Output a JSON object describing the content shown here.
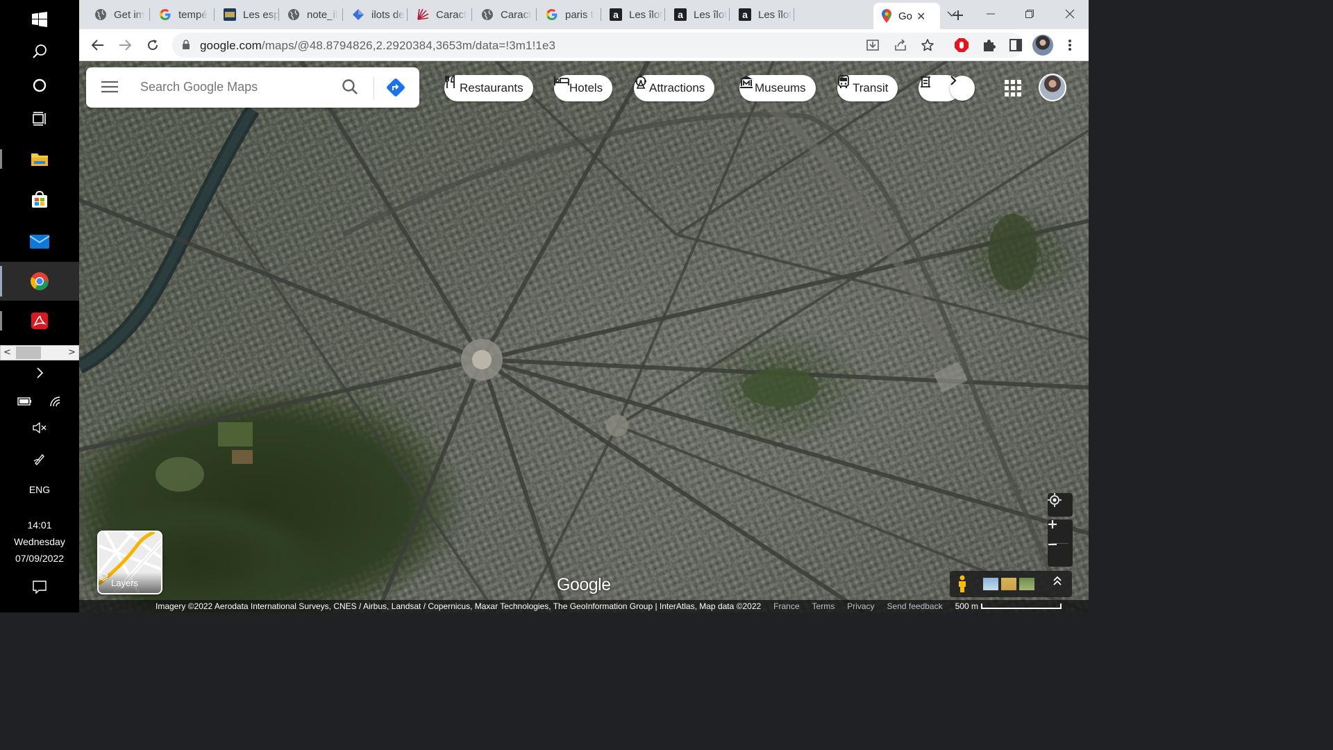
{
  "taskbar": {
    "icons": [
      "windows-start-icon",
      "search-icon",
      "cortana-icon",
      "task-view-icon",
      "file-explorer-icon",
      "microsoft-store-icon",
      "mail-icon",
      "chrome-icon",
      "acrobat-icon"
    ],
    "tray_icons": [
      "chevron-right-icon",
      "battery-icon",
      "wifi-icon",
      "mute-icon",
      "pen-icon"
    ],
    "language": "ENG",
    "time": "14:01",
    "day": "Wednesday",
    "date": "07/09/2022"
  },
  "tabs": [
    {
      "title": "Get im",
      "icon": "globe-icon"
    },
    {
      "title": "tempé",
      "icon": "google-icon"
    },
    {
      "title": "Les esp",
      "icon": "c21-icon"
    },
    {
      "title": "note_il",
      "icon": "globe-icon"
    },
    {
      "title": "ilots de",
      "icon": "diamond-icon"
    },
    {
      "title": "Caract",
      "icon": "sunburst-icon"
    },
    {
      "title": "Caract",
      "icon": "globe-icon"
    },
    {
      "title": "paris t",
      "icon": "google-icon"
    },
    {
      "title": "Les îlot",
      "icon": "a-icon"
    },
    {
      "title": "Les îlot",
      "icon": "a-icon"
    },
    {
      "title": "Les îlot",
      "icon": "a-icon"
    }
  ],
  "active_tab": {
    "title": "Go",
    "icon": "maps-pin-icon"
  },
  "toolbar": {
    "url_host": "google.com",
    "url_path": "/maps/@48.8794826,2.2920384,3653m/data=!3m1!1e3"
  },
  "maps": {
    "search_placeholder": "Search Google Maps",
    "chips": [
      {
        "label": "Restaurants",
        "icon": "fork-knife-icon"
      },
      {
        "label": "Hotels",
        "icon": "bed-icon"
      },
      {
        "label": "Attractions",
        "icon": "ferris-wheel-icon"
      },
      {
        "label": "Museums",
        "icon": "museum-icon"
      },
      {
        "label": "Transit",
        "icon": "bus-icon"
      },
      {
        "label": "",
        "icon": "atm-icon"
      }
    ],
    "layers_label": "Layers",
    "logo": "Google",
    "attribution": {
      "imagery": "Imagery ©2022 Aerodata International Surveys, CNES / Airbus, Landsat / Copernicus, Maxar Technologies, The GeoInformation Group | InterAtlas, Map data ©2022",
      "country": "France",
      "terms": "Terms",
      "privacy": "Privacy",
      "feedback": "Send feedback",
      "scale": "500 m"
    }
  }
}
